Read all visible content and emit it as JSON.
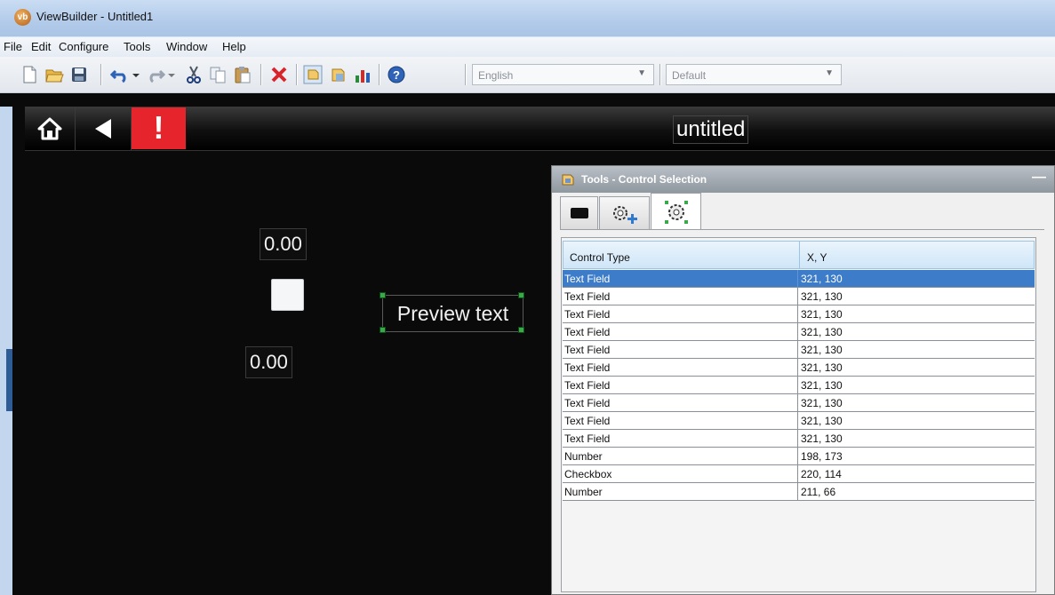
{
  "window": {
    "title": "ViewBuilder - Untitled1",
    "logo_text": "vb"
  },
  "menu": [
    "File",
    "Edit",
    "Configure",
    "Tools",
    "Window",
    "Help"
  ],
  "toolbar": {
    "icons": [
      "new-file-icon",
      "open-folder-icon",
      "save-icon",
      "undo-icon",
      "redo-icon",
      "cut-icon",
      "copy-icon",
      "paste-icon",
      "delete-icon",
      "preview-icon",
      "properties-icon",
      "chart-icon",
      "help-icon"
    ],
    "language_combo": "English",
    "theme_combo": "Default"
  },
  "screen": {
    "title": "untitled",
    "alert_symbol": "!",
    "number_field_top": "0.00",
    "number_field_bottom": "0.00",
    "preview_text": "Preview text"
  },
  "tools_panel": {
    "title": "Tools - Control Selection",
    "minimize": "—",
    "columns": [
      "Control Type",
      "X, Y"
    ],
    "rows": [
      {
        "type": "Text Field",
        "xy": "321, 130",
        "selected": true
      },
      {
        "type": "Text Field",
        "xy": "321, 130"
      },
      {
        "type": "Text Field",
        "xy": "321, 130"
      },
      {
        "type": "Text Field",
        "xy": "321, 130"
      },
      {
        "type": "Text Field",
        "xy": "321, 130"
      },
      {
        "type": "Text Field",
        "xy": "321, 130"
      },
      {
        "type": "Text Field",
        "xy": "321, 130"
      },
      {
        "type": "Text Field",
        "xy": "321, 130"
      },
      {
        "type": "Text Field",
        "xy": "321, 130"
      },
      {
        "type": "Text Field",
        "xy": "321, 130"
      },
      {
        "type": "Number",
        "xy": "198, 173"
      },
      {
        "type": "Checkbox",
        "xy": "220, 114"
      },
      {
        "type": "Number",
        "xy": "211, 66"
      }
    ]
  },
  "colors": {
    "selection": "#3d7cc9",
    "alert": "#e5252b",
    "canvas": "#0a0a0a"
  }
}
